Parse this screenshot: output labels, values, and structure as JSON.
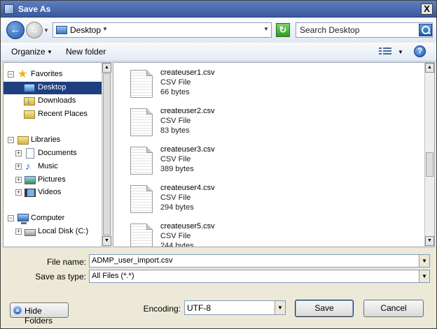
{
  "window": {
    "title": "Save As",
    "close_label": "X"
  },
  "navbar": {
    "back_icon": "back-arrow-icon",
    "forward_icon": "forward-arrow-icon",
    "address_location": "Desktop",
    "search_placeholder": "Search Desktop"
  },
  "toolbar": {
    "organize_label": "Organize",
    "new_folder_label": "New folder"
  },
  "nav": {
    "favorites": {
      "label": "Favorites",
      "expanded": true
    },
    "desktop": {
      "label": "Desktop",
      "selected": true
    },
    "downloads": {
      "label": "Downloads"
    },
    "recent": {
      "label": "Recent Places"
    },
    "libraries": {
      "label": "Libraries",
      "expanded": true
    },
    "documents": {
      "label": "Documents"
    },
    "music": {
      "label": "Music"
    },
    "pictures": {
      "label": "Pictures"
    },
    "videos": {
      "label": "Videos"
    },
    "computer": {
      "label": "Computer",
      "expanded": true
    },
    "localdisk": {
      "label": "Local Disk (C:)"
    }
  },
  "files": [
    {
      "name": "createuser1.csv",
      "type": "CSV File",
      "size": "66 bytes"
    },
    {
      "name": "createuser2.csv",
      "type": "CSV File",
      "size": "83 bytes"
    },
    {
      "name": "createuser3.csv",
      "type": "CSV File",
      "size": "389 bytes"
    },
    {
      "name": "createuser4.csv",
      "type": "CSV File",
      "size": "294 bytes"
    },
    {
      "name": "createuser5.csv",
      "type": "CSV File",
      "size": "244 bytes"
    }
  ],
  "form": {
    "file_name_label": "File name:",
    "file_name_value": "ADMP_user_import.csv",
    "save_type_label": "Save as type:",
    "save_type_value": "All Files  (*.*)",
    "encoding_label": "Encoding:",
    "encoding_value": "UTF-8"
  },
  "buttons": {
    "hide_folders": "Hide Folders",
    "save": "Save",
    "cancel": "Cancel"
  },
  "colors": {
    "title_bar": "#3a5a9e",
    "selection": "#1f3f7f"
  }
}
